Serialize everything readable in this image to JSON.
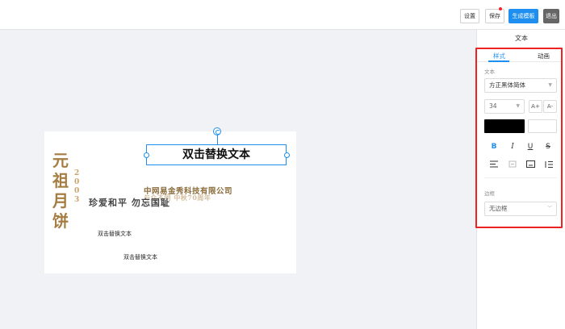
{
  "toolbar": {
    "settings_label": "设置",
    "save_label": "保存",
    "generate_label": "生成模板",
    "exit_label": "退出"
  },
  "stage": {
    "headline": "双击替换文本",
    "small_text_1": "双击替换文本",
    "small_text_2": "双击替换文本",
    "gold_big_chars": "元祖月饼",
    "gold_year": "2003",
    "company": "中网易金秀科技有限公司",
    "motto": "珍爱和平 勿忘国耻",
    "subtitle": "与众不同 中秋70周年"
  },
  "panel": {
    "title": "文本",
    "tabs": [
      "样式",
      "动画"
    ],
    "active_tab": "样式",
    "text_section_label": "文本",
    "font_family": "方正黑体简体",
    "font_size": "34",
    "increase_label": "A+",
    "decrease_label": "A-",
    "text_color": "#000000",
    "style_icons": {
      "bold": "B",
      "italic": "I",
      "underline": "U",
      "strike": "S"
    },
    "border_section_label": "边框",
    "border_value": "无边框"
  },
  "colors": {
    "accent": "#1e8ff0",
    "highlight_frame": "#ee2222",
    "gold": "#a57d42"
  }
}
